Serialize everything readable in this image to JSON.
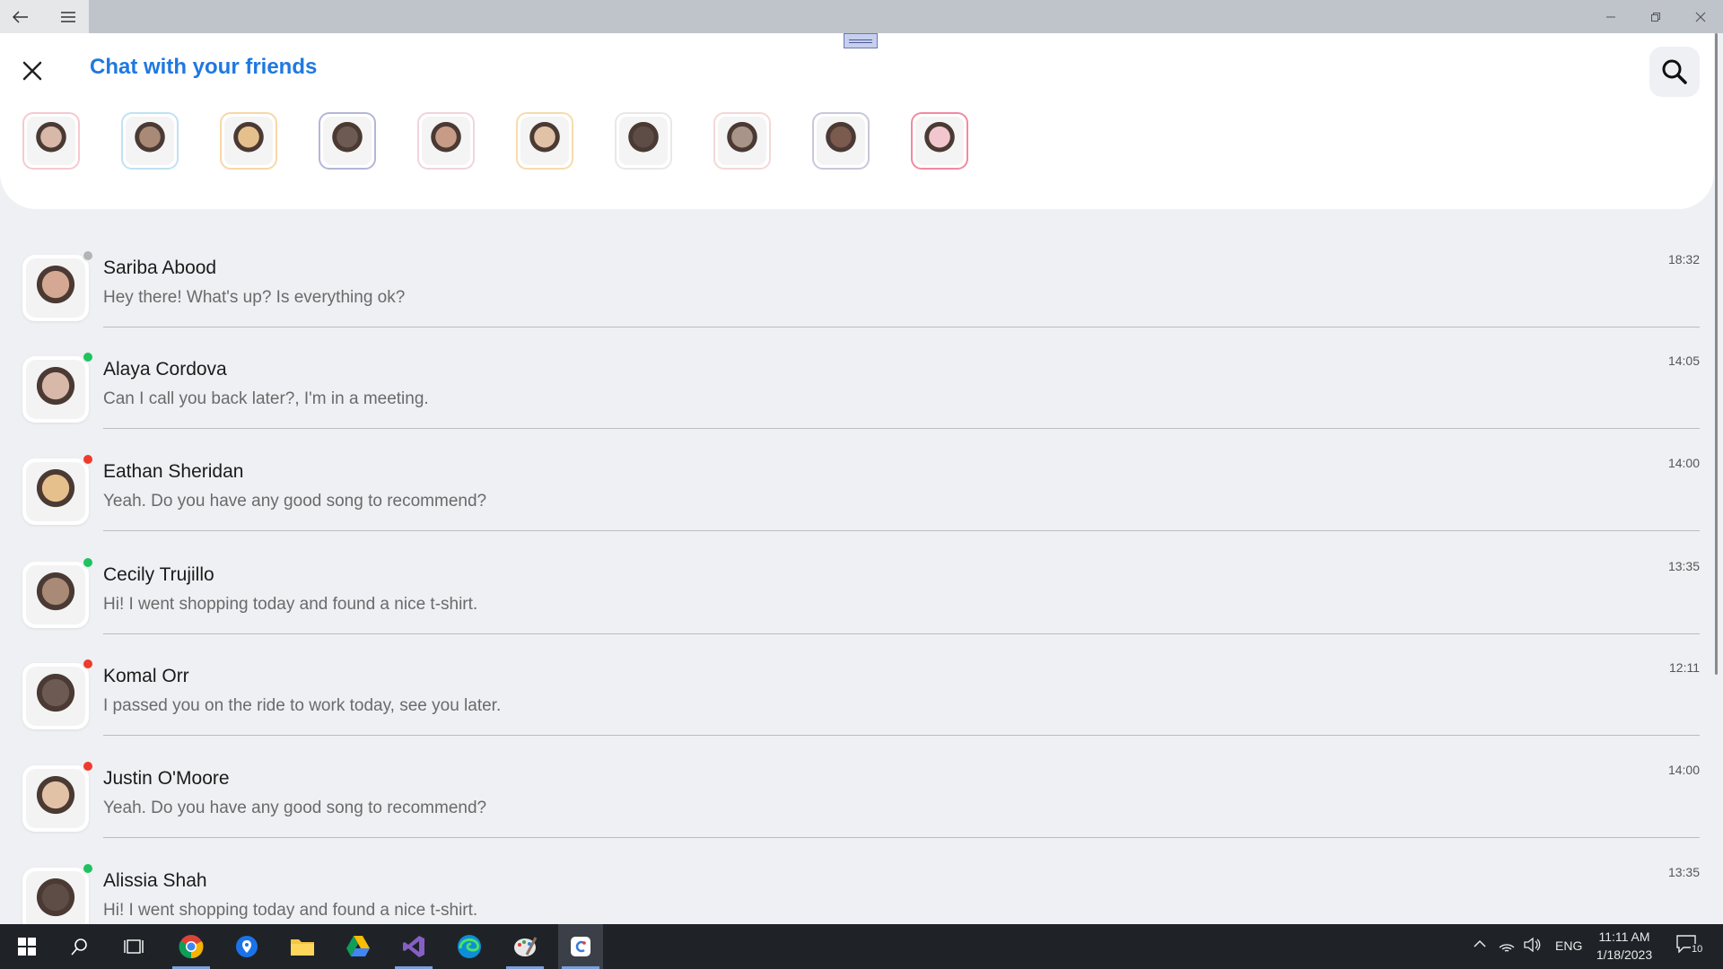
{
  "app": {
    "title": "Chat with your friends",
    "accent_color": "#1f78e0"
  },
  "stories": [
    {
      "name": "story-1",
      "border": "#f5c9d0",
      "face": "#d8b8a8"
    },
    {
      "name": "story-2",
      "border": "#bfe2f2",
      "face": "#a88a76"
    },
    {
      "name": "story-3",
      "border": "#f8d7a8",
      "face": "#e6c08c"
    },
    {
      "name": "story-4",
      "border": "#b4b6d8",
      "face": "#6d5a52"
    },
    {
      "name": "story-5",
      "border": "#f0d4dc",
      "face": "#c89b86"
    },
    {
      "name": "story-6",
      "border": "#f6dcae",
      "face": "#e2c2a6"
    },
    {
      "name": "story-7",
      "border": "#e8e8e8",
      "face": "#5e4c46"
    },
    {
      "name": "story-8",
      "border": "#f4d8d8",
      "face": "#a89488"
    },
    {
      "name": "story-9",
      "border": "#c8c8da",
      "face": "#7a5b4e"
    },
    {
      "name": "story-10",
      "border": "#f28aa0",
      "face": "#f2c6cf"
    }
  ],
  "chats": [
    {
      "name": "Sariba Abood",
      "message": "Hey there! What's up? Is everything ok?",
      "time": "18:32",
      "status": "offline",
      "status_color": "#b4b4b4",
      "face": "#d4a892"
    },
    {
      "name": "Alaya Cordova",
      "message": "Can I call you back later?, I'm in a meeting.",
      "time": "14:05",
      "status": "online",
      "status_color": "#1fc25f",
      "face": "#d8b8a8"
    },
    {
      "name": "Eathan Sheridan",
      "message": "Yeah. Do you have any good song to recommend?",
      "time": "14:00",
      "status": "busy",
      "status_color": "#ee3b2c",
      "face": "#e6c08c"
    },
    {
      "name": "Cecily Trujillo",
      "message": "Hi! I went shopping today and found a nice t-shirt.",
      "time": "13:35",
      "status": "online",
      "status_color": "#1fc25f",
      "face": "#a88a76"
    },
    {
      "name": "Komal Orr",
      "message": "I passed you on the ride to work today, see you later.",
      "time": "12:11",
      "status": "busy",
      "status_color": "#ee3b2c",
      "face": "#6d5a52"
    },
    {
      "name": "Justin O'Moore",
      "message": "Yeah. Do you have any good song to recommend?",
      "time": "14:00",
      "status": "busy",
      "status_color": "#ee3b2c",
      "face": "#e2c2a6"
    },
    {
      "name": "Alissia Shah",
      "message": "Hi! I went shopping today and found a nice t-shirt.",
      "time": "13:35",
      "status": "online",
      "status_color": "#1fc25f",
      "face": "#5e4c46"
    }
  ],
  "taskbar": {
    "apps": [
      "start-icon",
      "search-icon",
      "task-view-icon",
      "chrome-icon",
      "maps-icon",
      "file-explorer-icon",
      "google-drive-icon",
      "visual-studio-icon",
      "edge-icon",
      "paint-icon",
      "chat-app-icon"
    ],
    "language": "ENG",
    "time": "11:11 AM",
    "date": "1/18/2023",
    "notifications": "10"
  }
}
